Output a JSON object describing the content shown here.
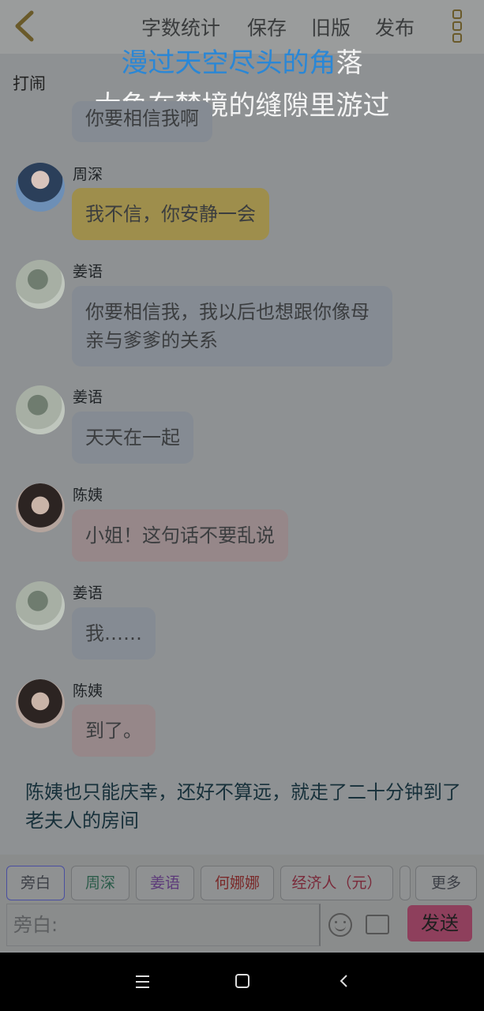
{
  "topbar": {
    "menu": [
      "字数统计",
      "保存",
      "旧版",
      "发布"
    ]
  },
  "lyric": {
    "line1_highlight": "漫过天空尽头的角",
    "line1_rest": "落",
    "line2": "大鱼在梦境的缝隙里游过"
  },
  "side_label": "打闹",
  "messages": [
    {
      "speaker": "",
      "text": "你要相信我啊",
      "color": "gray"
    },
    {
      "speaker": "周深",
      "text": "我不信，你安静一会",
      "color": "yellow"
    },
    {
      "speaker": "姜语",
      "text": "你要相信我，我以后也想跟你像母亲与爹爹的关系",
      "color": "gray"
    },
    {
      "speaker": "姜语",
      "text": "天天在一起",
      "color": "gray"
    },
    {
      "speaker": "陈姨",
      "text": "小姐！这句话不要乱说",
      "color": "pink"
    },
    {
      "speaker": "姜语",
      "text": "我……",
      "color": "gray"
    },
    {
      "speaker": "陈姨",
      "text": "到了。",
      "color": "pink"
    }
  ],
  "narration": "陈姨也只能庆幸，还好不算远，就走了二十分钟到了老夫人的房间",
  "tabs": [
    {
      "label": "旁白",
      "color": "#3c3f46"
    },
    {
      "label": "周深",
      "color": "#2c5c4a"
    },
    {
      "label": "姜语",
      "color": "#5d3a7a"
    },
    {
      "label": "何娜娜",
      "color": "#7a2a2a"
    },
    {
      "label": "经济人（元）",
      "color": "#7a2a3a"
    },
    {
      "label": "更多",
      "color": "#3c3f46"
    }
  ],
  "input": {
    "placeholder": "旁白:"
  },
  "send_label": "发送"
}
